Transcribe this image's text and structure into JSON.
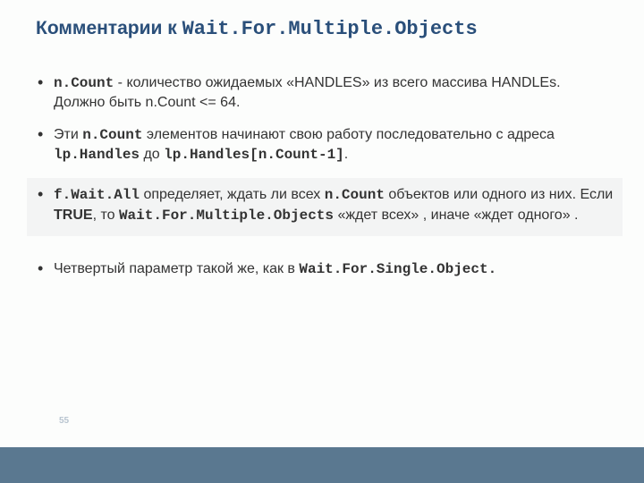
{
  "title": {
    "prefix": "Комментарии к ",
    "code": "Wait.For.Multiple.Objects"
  },
  "bul1": {
    "c1": "n.Count",
    "t1": " - количество ожидаемых «HANDLES» из всего массива HANDLEs. Должно быть n.Count <= 64."
  },
  "bul2": {
    "t1": "Эти ",
    "c1": "n.Count",
    "t2": " элементов начинают свою работу последовательно с адреса ",
    "c2": "lp.Handles",
    "t3": " до ",
    "c3": "lp.Handles[n.Count-1]",
    "t4": "."
  },
  "bul3": {
    "c1": "f.Wait.All",
    "t1": " определяет, ждать ли всех ",
    "c2": "n.Count",
    "t2": " объектов или одного из них. Если ",
    "c3": "TRUE",
    "t3": ", то ",
    "c4": "Wait.For.Multiple.Objects",
    "t4": " «ждет всех» , иначе «ждет одного» ."
  },
  "bul4": {
    "t1": "Четвертый параметр такой же, как в ",
    "c1": "Wait.For.Single.Object.",
    "t2": ""
  },
  "page_number": "55"
}
